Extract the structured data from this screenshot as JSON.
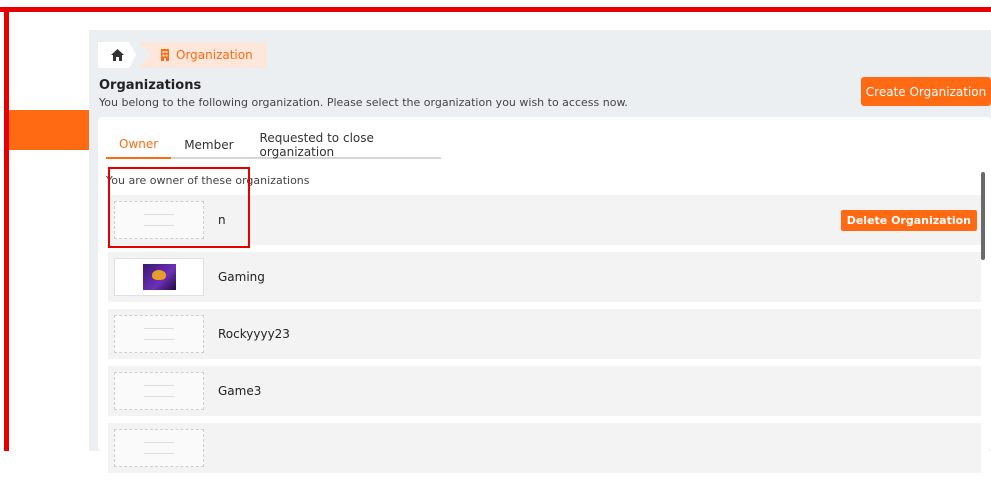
{
  "breadcrumb": {
    "home_icon": "home-icon",
    "org_icon": "building-icon",
    "current": "Organization"
  },
  "header": {
    "title": "Organizations",
    "subtitle": "You belong to the following organization. Please select the organization you wish to access now.",
    "create_label": "Create Organization"
  },
  "tabs": [
    {
      "label": "Owner",
      "active": true
    },
    {
      "label": "Member",
      "active": false
    },
    {
      "label": "Requested to close organization",
      "active": false
    }
  ],
  "owner_text": "You are owner of these organizations",
  "organizations": [
    {
      "name": "n",
      "logo": "placeholder",
      "delete_label": "Delete Organization"
    },
    {
      "name": "Gaming",
      "logo": "gaming"
    },
    {
      "name": "Rockyyyy23",
      "logo": "placeholder"
    },
    {
      "name": "Game3",
      "logo": "placeholder"
    },
    {
      "name": "",
      "logo": "placeholder"
    }
  ],
  "colors": {
    "accent": "#ff6a13",
    "highlight": "#e60000",
    "background": "#eceff1"
  }
}
